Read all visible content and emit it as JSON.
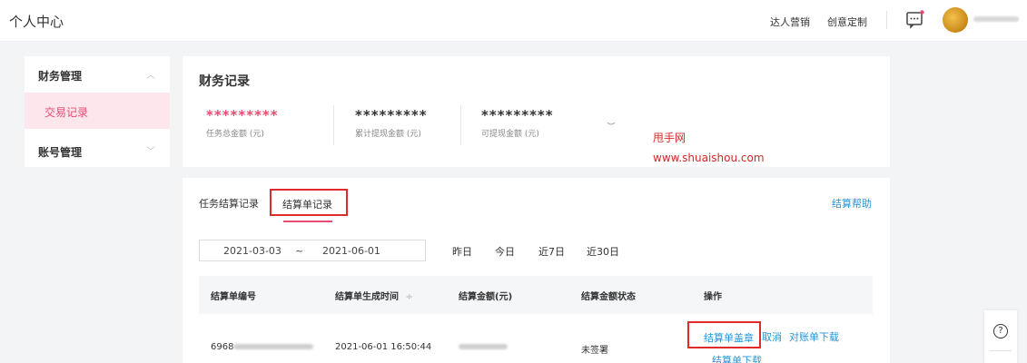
{
  "header": {
    "title": "个人中心",
    "links": [
      "达人营销",
      "创意定制"
    ]
  },
  "sidebar": {
    "groups": [
      {
        "label": "财务管理",
        "expanded": true,
        "items": [
          "交易记录"
        ]
      },
      {
        "label": "账号管理",
        "expanded": false
      }
    ]
  },
  "finance": {
    "title": "财务记录",
    "stats": [
      {
        "value": "*********",
        "caption": "任务总金额 (元)",
        "color": "#e94a72"
      },
      {
        "value": "*********",
        "caption": "累计提现金额 (元)",
        "color": "#333333"
      },
      {
        "value": "*********",
        "caption": "可提现金额 (元)",
        "color": "#333333"
      }
    ]
  },
  "watermark": {
    "name": "甩手网",
    "url": "www.shuaishou.com"
  },
  "records": {
    "tabs": [
      "任务结算记录",
      "结算单记录"
    ],
    "active_tab": 1,
    "help": "结算帮助",
    "date_from": "2021-03-03",
    "date_sep": "~",
    "date_to": "2021-06-01",
    "quick_ranges": [
      "昨日",
      "今日",
      "近7日",
      "近30日"
    ],
    "columns": [
      "结算单编号",
      "结算单生成时间",
      "结算金额(元)",
      "结算金额状态",
      "操作"
    ],
    "sort_glyph": "÷",
    "rows": [
      {
        "id_prefix": "6968",
        "created": "2021-06-01 16:50:44",
        "status": "未签署",
        "actions": [
          "结算单盖章",
          "取消",
          "对账单下载",
          "结算单下载"
        ]
      }
    ]
  },
  "float": {
    "icon": "question-icon",
    "glyph": "?"
  }
}
